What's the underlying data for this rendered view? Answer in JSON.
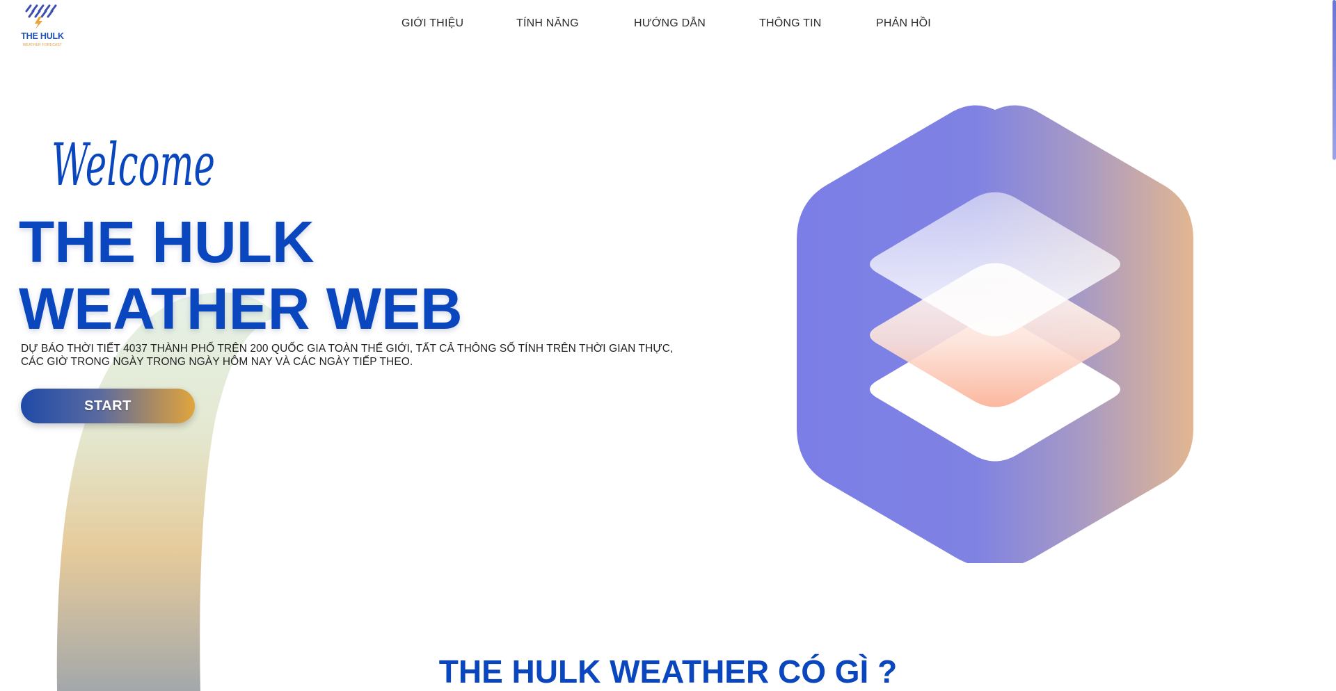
{
  "logo": {
    "name": "THE HULK",
    "tagline": "WEATHER FORECAST"
  },
  "nav": {
    "items": [
      {
        "label": "GIỚI THIỆU"
      },
      {
        "label": "TÍNH NĂNG"
      },
      {
        "label": "HƯỚNG DẪN"
      },
      {
        "label": "THÔNG TIN"
      },
      {
        "label": "PHẢN HỒI"
      }
    ]
  },
  "hero": {
    "welcome": "Welcome",
    "title_line1": "THE HULK",
    "title_line2": "WEATHER WEB",
    "description": "DỰ BÁO THỜI TIẾT 4037 THÀNH PHỐ TRÊN 200 QUỐC GIA TOÀN THẾ GIỚI, TẤT CẢ THÔNG SỐ TÍNH TRÊN THỜI GIAN THỰC, CÁC GIỜ TRONG NGÀY TRONG NGÀY HÔM NAY VÀ CÁC NGÀY TIẾP THEO.",
    "start_label": "START"
  },
  "section": {
    "title": "THE HULK WEATHER CÓ GÌ ?"
  },
  "colors": {
    "brand_blue": "#0a47be",
    "hex_violet": "#7b7ee6",
    "hex_peach": "#dcb49a",
    "accent_orange": "#e0a53d"
  },
  "icons": {
    "logo": "hulk-logo-icon",
    "hero": "layers-hexagon-icon"
  }
}
